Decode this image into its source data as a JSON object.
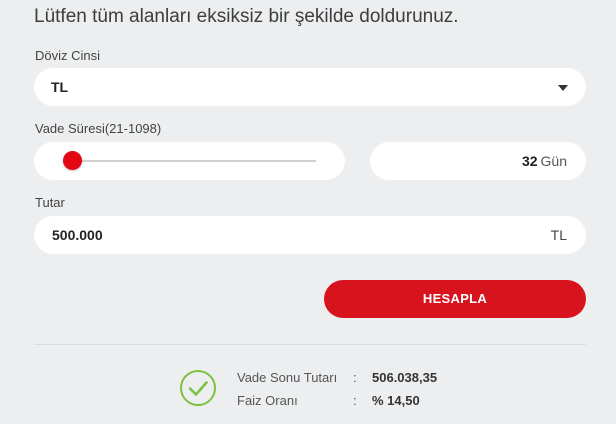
{
  "form": {
    "title": "Lütfen tüm alanları eksiksiz bir şekilde doldurunuz.",
    "currency_label": "Döviz Cinsi",
    "currency_value": "TL",
    "term_label": "Vade Süresi(21-1098)",
    "term_slider": {
      "min": 21,
      "max": 1098,
      "value": 32
    },
    "term_days": "32",
    "term_unit": "Gün",
    "amount_label": "Tutar",
    "amount_value": "500.000",
    "amount_currency": "TL",
    "calculate_label": "HESAPLA"
  },
  "result": {
    "maturity_label": "Vade Sonu Tutarı",
    "maturity_value": "506.038,35",
    "rate_label": "Faiz Oranı",
    "rate_value": "% 14,50",
    "separator": ":"
  },
  "colors": {
    "accent": "#d7141e",
    "success": "#7cc242",
    "background": "#eceef0"
  },
  "icons": [
    "chevron-down-icon",
    "check-circle-icon"
  ]
}
